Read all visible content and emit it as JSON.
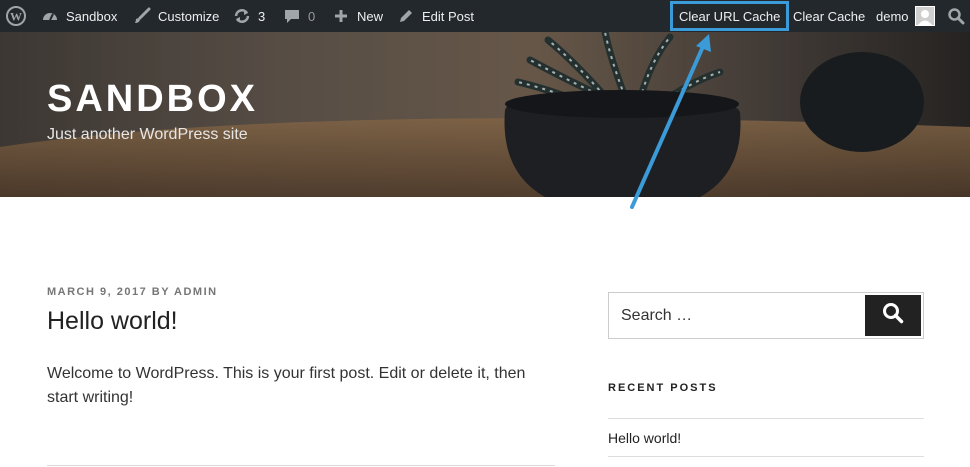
{
  "adminbar": {
    "site_name": "Sandbox",
    "customize": "Customize",
    "updates_count": "3",
    "comments_count": "0",
    "new_label": "New",
    "edit_post": "Edit Post",
    "clear_url_cache": "Clear URL Cache",
    "clear_cache": "Clear Cache",
    "user": "demo"
  },
  "header": {
    "title": "SANDBOX",
    "description": "Just another WordPress site"
  },
  "post": {
    "date": "MARCH 9, 2017",
    "by": "BY",
    "author": "ADMIN",
    "title": "Hello world!",
    "excerpt": "Welcome to WordPress. This is your first post. Edit or delete it, then start writing!"
  },
  "sidebar": {
    "search_placeholder": "Search …",
    "recent_heading": "RECENT POSTS",
    "recent_posts": [
      "Hello world!"
    ]
  },
  "colors": {
    "adminbar_bg": "#23282d",
    "highlight_border": "#3b9ad8",
    "annotation_arrow": "#3b9ad8",
    "search_button_bg": "#222222"
  }
}
